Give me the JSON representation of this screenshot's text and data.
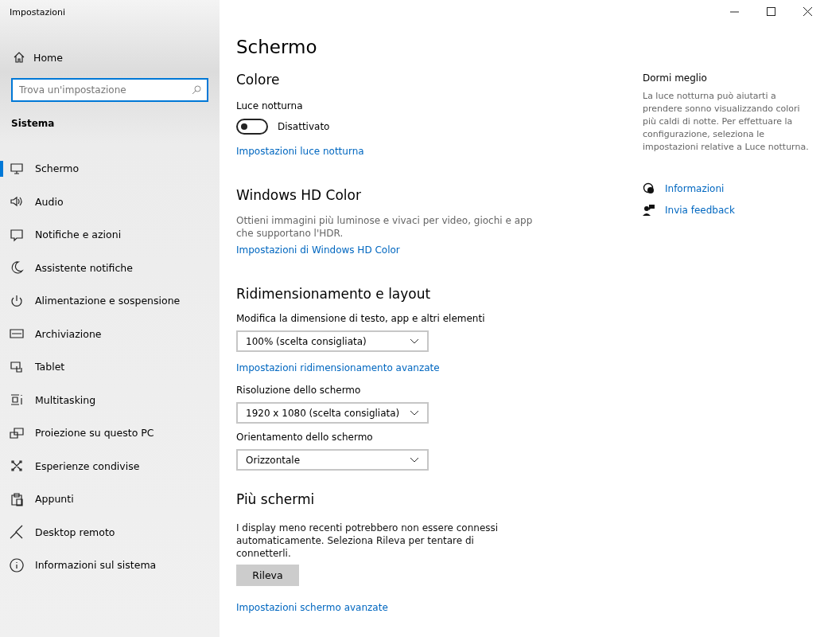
{
  "window": {
    "title": "Impostazioni"
  },
  "sidebar": {
    "home": "Home",
    "search": {
      "placeholder": "Trova un'impostazione"
    },
    "section": "Sistema",
    "items": [
      {
        "label": "Schermo",
        "selected": true
      },
      {
        "label": "Audio",
        "selected": false
      },
      {
        "label": "Notifiche e azioni",
        "selected": false
      },
      {
        "label": "Assistente notifiche",
        "selected": false
      },
      {
        "label": "Alimentazione e sospensione",
        "selected": false
      },
      {
        "label": "Archiviazione",
        "selected": false
      },
      {
        "label": "Tablet",
        "selected": false
      },
      {
        "label": "Multitasking",
        "selected": false
      },
      {
        "label": "Proiezione su questo PC",
        "selected": false
      },
      {
        "label": "Esperienze condivise",
        "selected": false
      },
      {
        "label": "Appunti",
        "selected": false
      },
      {
        "label": "Desktop remoto",
        "selected": false
      },
      {
        "label": "Informazioni sul sistema",
        "selected": false
      }
    ]
  },
  "page": {
    "title": "Schermo",
    "color": {
      "heading": "Colore",
      "night_light": {
        "label": "Luce notturna",
        "on": false,
        "state": "Disattivato"
      },
      "link": "Impostazioni luce notturna"
    },
    "hdr": {
      "heading": "Windows HD Color",
      "description": "Ottieni immagini più luminose e vivaci per video, giochi e app che supportano l'HDR.",
      "link": "Impostazioni di Windows HD Color"
    },
    "scale": {
      "heading": "Ridimensionamento e layout",
      "fields": [
        {
          "label": "Modifica la dimensione di testo, app e altri elementi",
          "value": "100% (scelta consigliata)",
          "link": "Impostazioni ridimensionamento avanzate"
        },
        {
          "label": "Risoluzione dello schermo",
          "value": "1920 x 1080 (scelta consigliata)"
        },
        {
          "label": "Orientamento dello schermo",
          "value": "Orizzontale"
        }
      ]
    },
    "multi": {
      "heading": "Più schermi",
      "description": "I display meno recenti potrebbero non essere connessi automaticamente. Seleziona Rileva per tentare di connetterli.",
      "button": "Rileva",
      "link": "Impostazioni schermo avanzate"
    }
  },
  "aside": {
    "heading": "Dormi meglio",
    "text": "La luce notturna può aiutarti a prendere sonno visualizzando colori più caldi di notte. Per effettuare la configurazione, seleziona le impostazioni relative a Luce notturna.",
    "links": [
      "Informazioni",
      "Invia feedback"
    ]
  }
}
